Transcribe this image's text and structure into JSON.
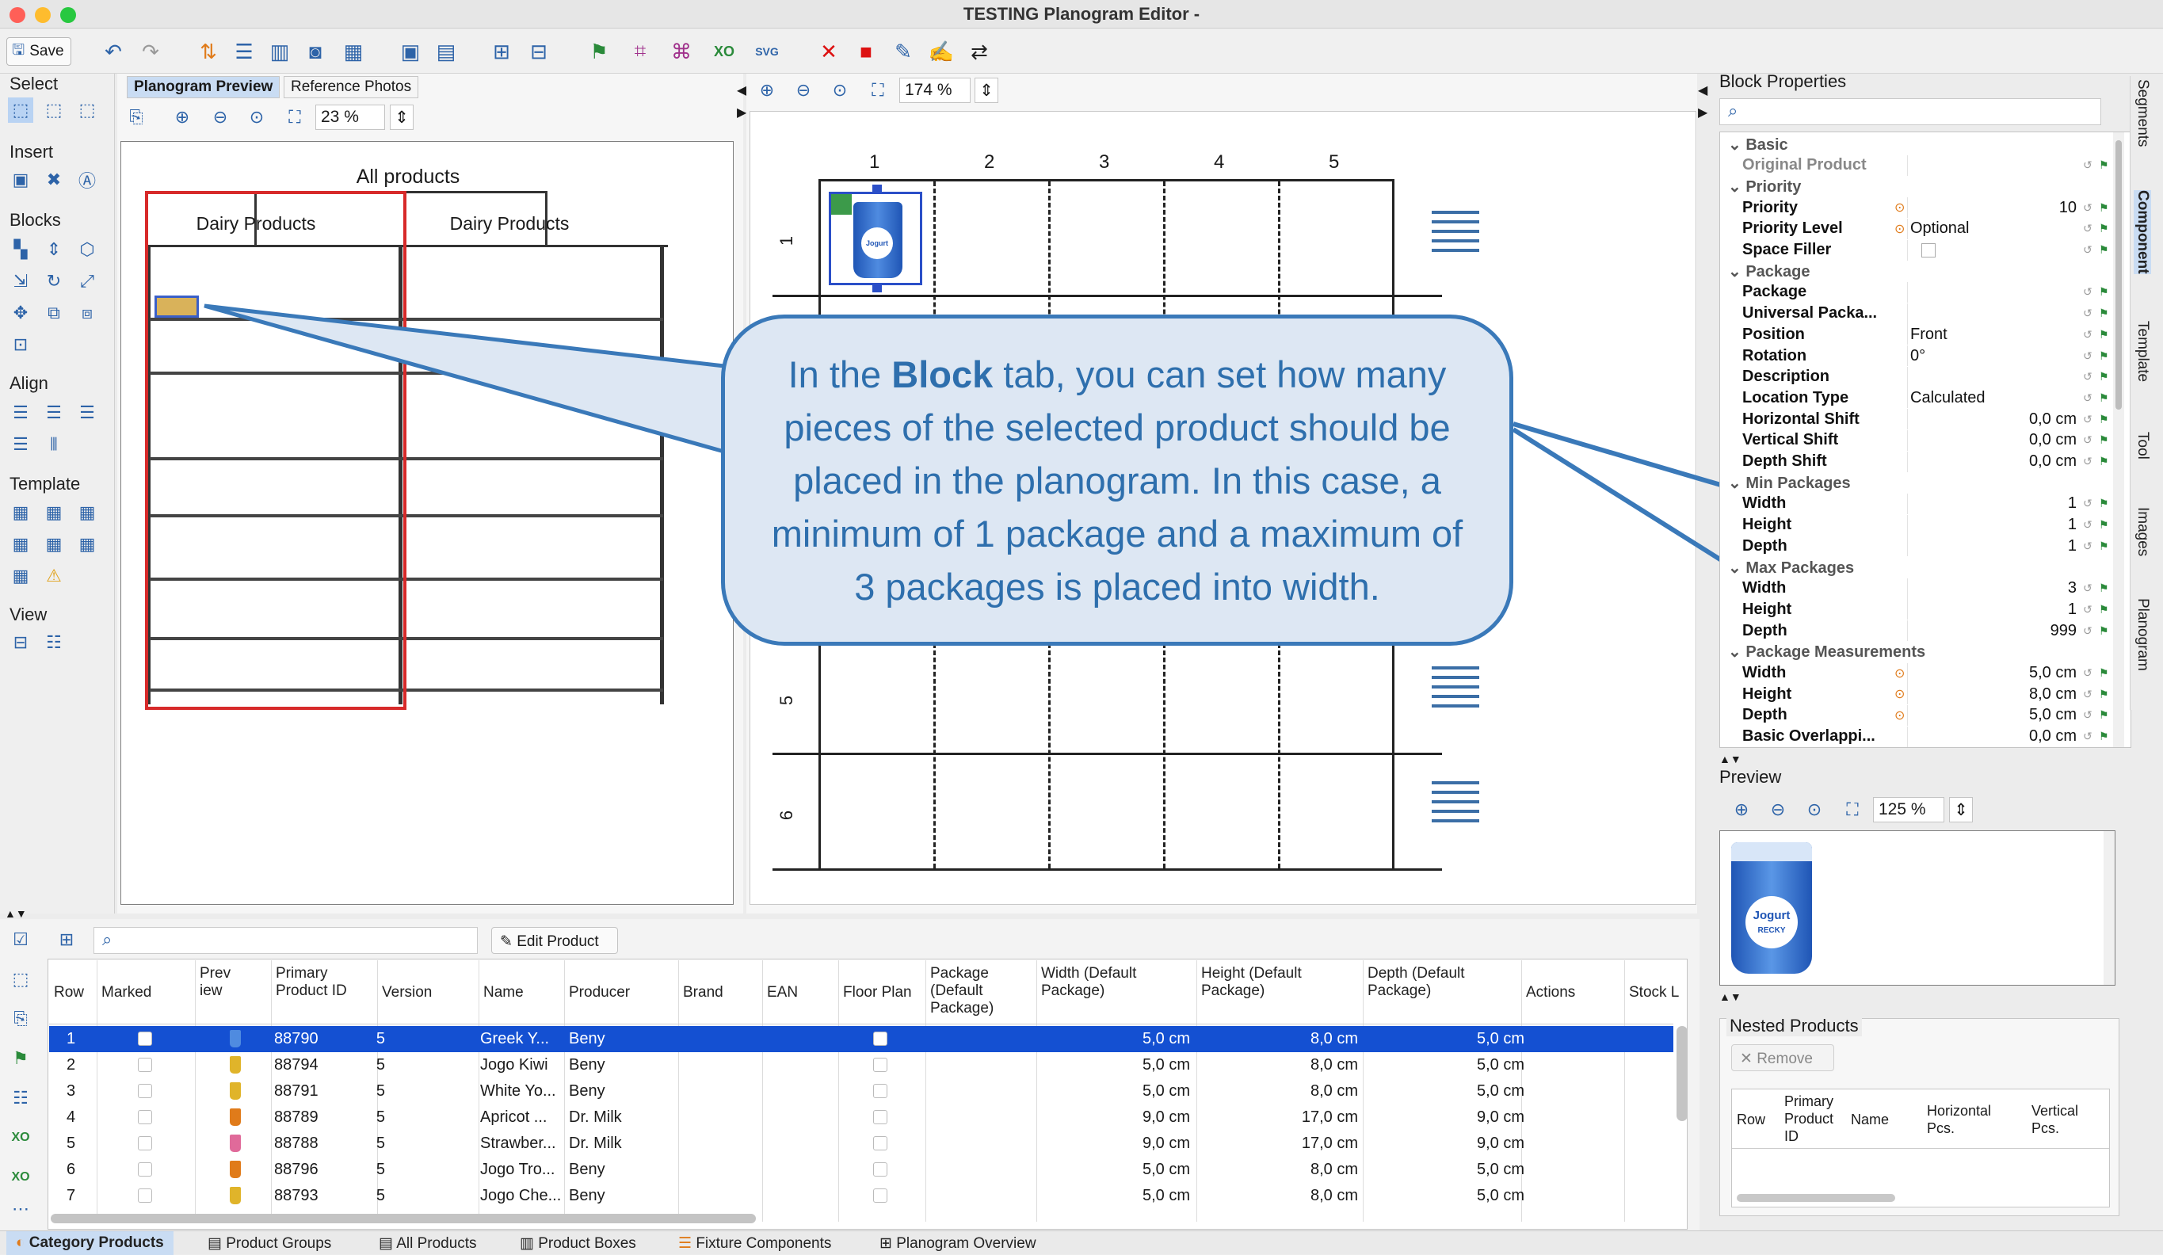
{
  "window": {
    "title": "TESTING Planogram Editor -"
  },
  "toolbar": {
    "save_label": "Save"
  },
  "left_tools": {
    "groups": [
      "Select",
      "Insert",
      "Blocks",
      "Align",
      "Template",
      "View"
    ]
  },
  "preview_tabs": [
    "Planogram Preview",
    "Reference Photos"
  ],
  "preview_zoom": "23 %",
  "mini_planogram": {
    "header": "All products",
    "cat1": "Dairy Products",
    "cat2": "Dairy Products"
  },
  "main_zoom": "174 %",
  "columns": [
    "1",
    "2",
    "3",
    "4",
    "5"
  ],
  "rows": [
    "1",
    "5",
    "6"
  ],
  "callout": {
    "pre": "In the ",
    "bold": "Block",
    "post": " tab, you can set how many pieces of the selected product should be placed in the planogram. In this case, a minimum of 1 package and a maximum of 3 packages is placed into width."
  },
  "block_properties": {
    "title": "Block Properties",
    "items": [
      {
        "type": "group",
        "label": "Basic"
      },
      {
        "type": "prop",
        "name": "Original Product",
        "value": "",
        "dim": true
      },
      {
        "type": "group",
        "label": "Priority"
      },
      {
        "type": "prop",
        "name": "Priority",
        "value": "10",
        "icon": true
      },
      {
        "type": "prop",
        "name": "Priority Level",
        "value": "Optional",
        "icon": true
      },
      {
        "type": "prop",
        "name": "Space Filler",
        "value": "",
        "check": true
      },
      {
        "type": "group",
        "label": "Package"
      },
      {
        "type": "prop",
        "name": "Package",
        "value": ""
      },
      {
        "type": "prop",
        "name": "Universal Packa...",
        "value": ""
      },
      {
        "type": "prop",
        "name": "Position",
        "value": "Front"
      },
      {
        "type": "prop",
        "name": "Rotation",
        "value": "0°"
      },
      {
        "type": "prop",
        "name": "Description",
        "value": ""
      },
      {
        "type": "prop",
        "name": "Location Type",
        "value": "Calculated"
      },
      {
        "type": "prop",
        "name": "Horizontal Shift",
        "value": "0,0 cm"
      },
      {
        "type": "prop",
        "name": "Vertical Shift",
        "value": "0,0 cm"
      },
      {
        "type": "prop",
        "name": "Depth Shift",
        "value": "0,0 cm"
      },
      {
        "type": "group",
        "label": "Min Packages"
      },
      {
        "type": "prop",
        "name": "Width",
        "value": "1"
      },
      {
        "type": "prop",
        "name": "Height",
        "value": "1"
      },
      {
        "type": "prop",
        "name": "Depth",
        "value": "1"
      },
      {
        "type": "group",
        "label": "Max Packages"
      },
      {
        "type": "prop",
        "name": "Width",
        "value": "3"
      },
      {
        "type": "prop",
        "name": "Height",
        "value": "1"
      },
      {
        "type": "prop",
        "name": "Depth",
        "value": "999"
      },
      {
        "type": "group",
        "label": "Package Measurements"
      },
      {
        "type": "prop",
        "name": "Width",
        "value": "5,0 cm",
        "icon": true
      },
      {
        "type": "prop",
        "name": "Height",
        "value": "8,0 cm",
        "icon": true
      },
      {
        "type": "prop",
        "name": "Depth",
        "value": "5,0 cm",
        "icon": true
      },
      {
        "type": "prop",
        "name": "Basic Overlappi...",
        "value": "0,0 cm"
      }
    ]
  },
  "preview": {
    "title": "Preview",
    "zoom": "125 %",
    "jar_label": "Jogurt",
    "jar_sub": "RECKY"
  },
  "right_tabs": [
    "Segments",
    "Component",
    "Template",
    "Tool",
    "Images",
    "Planogram"
  ],
  "nested": {
    "title": "Nested Products",
    "remove_label": "Remove",
    "headers": [
      "Row",
      "Primary Product ID",
      "Name",
      "Horizontal Pcs.",
      "Vertical Pcs."
    ]
  },
  "products": {
    "edit_label": "Edit Product",
    "headers": [
      "Row",
      "Marked",
      "Prev iew",
      "Primary Product ID",
      "Version",
      "Name",
      "Producer",
      "Brand",
      "EAN",
      "Floor Plan",
      "Package (Default Package)",
      "Width (Default Package)",
      "Height (Default Package)",
      "Depth (Default Package)",
      "Actions",
      "Stock L"
    ],
    "rows": [
      {
        "row": "1",
        "id": "88790",
        "version": "5",
        "name": "Greek Y...",
        "producer": "Beny",
        "width": "5,0 cm",
        "height": "8,0 cm",
        "depth": "5,0 cm"
      },
      {
        "row": "2",
        "id": "88794",
        "version": "5",
        "name": "Jogo Kiwi",
        "producer": "Beny",
        "width": "5,0 cm",
        "height": "8,0 cm",
        "depth": "5,0 cm"
      },
      {
        "row": "3",
        "id": "88791",
        "version": "5",
        "name": "White Yo...",
        "producer": "Beny",
        "width": "5,0 cm",
        "height": "8,0 cm",
        "depth": "5,0 cm"
      },
      {
        "row": "4",
        "id": "88789",
        "version": "5",
        "name": "Apricot ...",
        "producer": "Dr. Milk",
        "width": "9,0 cm",
        "height": "17,0 cm",
        "depth": "9,0 cm"
      },
      {
        "row": "5",
        "id": "88788",
        "version": "5",
        "name": "Strawber...",
        "producer": "Dr. Milk",
        "width": "9,0 cm",
        "height": "17,0 cm",
        "depth": "9,0 cm"
      },
      {
        "row": "6",
        "id": "88796",
        "version": "5",
        "name": "Jogo Tro...",
        "producer": "Beny",
        "width": "5,0 cm",
        "height": "8,0 cm",
        "depth": "5,0 cm"
      },
      {
        "row": "7",
        "id": "88793",
        "version": "5",
        "name": "Jogo Che...",
        "producer": "Beny",
        "width": "5,0 cm",
        "height": "8,0 cm",
        "depth": "5,0 cm"
      }
    ]
  },
  "bottom_tabs": [
    "Category Products",
    "Product Groups",
    "All Products",
    "Product Boxes",
    "Fixture Components",
    "Planogram Overview"
  ]
}
